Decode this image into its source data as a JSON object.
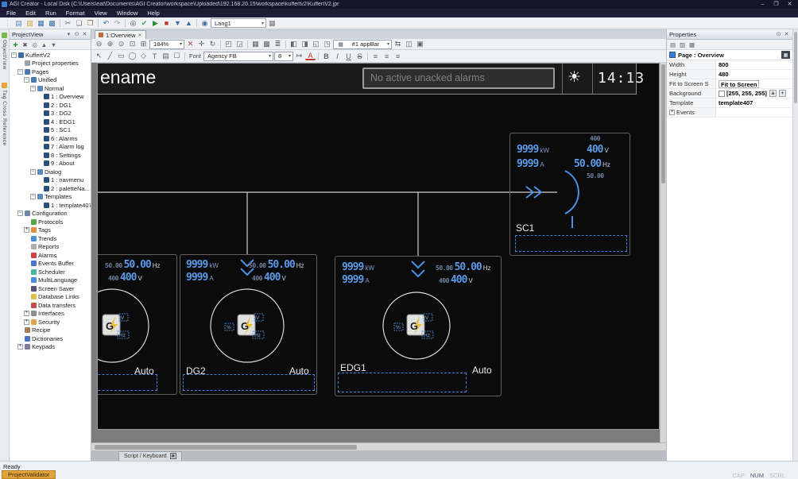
{
  "window": {
    "title": "AGI Creator - Local Disk (C:\\Users\\eat\\Documents\\AGI Creator\\workspace\\Uploaded\\192.168.20.15\\workspace\\kuffertv2\\KuffertV2.jpr",
    "controls": {
      "minimize": "–",
      "maximize": "❐",
      "close": "✕"
    }
  },
  "colors": {
    "accent_blue": "#4a90e2",
    "value_blue": "#5c9ae8",
    "selection_dash": "#3f7fd6",
    "validator_orange": "#e2a33c",
    "page_background": "#0b0b0b"
  },
  "menu": {
    "items": [
      "File",
      "Edit",
      "Run",
      "Format",
      "View",
      "Window",
      "Help"
    ]
  },
  "main_toolbar": {
    "language": "Lang1",
    "icons": [
      {
        "name": "new-project-icon",
        "glyph": "▤",
        "color": "#5b87c5"
      },
      {
        "name": "open-project-icon",
        "glyph": "▨",
        "color": "#d9a83c"
      },
      {
        "name": "save-icon",
        "glyph": "▦",
        "color": "#3a6ea5"
      },
      {
        "name": "save-all-icon",
        "glyph": "▩",
        "color": "#3a6ea5"
      },
      {
        "sep": true
      },
      {
        "name": "cut-icon",
        "glyph": "✂",
        "color": "#777777"
      },
      {
        "name": "copy-icon",
        "glyph": "❏",
        "color": "#777777"
      },
      {
        "name": "paste-icon",
        "glyph": "❐",
        "color": "#8a6d3b"
      },
      {
        "sep": true
      },
      {
        "name": "undo-icon",
        "glyph": "↶",
        "color": "#3a6ea5"
      },
      {
        "name": "redo-icon",
        "glyph": "↷",
        "color": "#8aa0b8"
      },
      {
        "sep": true
      },
      {
        "name": "find-icon",
        "glyph": "◎",
        "color": "#555555"
      },
      {
        "name": "validate-icon",
        "glyph": "✔",
        "color": "#3a9e3a"
      },
      {
        "name": "run-icon",
        "glyph": "▶",
        "color": "#2e8b2e"
      },
      {
        "name": "stop-icon",
        "glyph": "■",
        "color": "#c0392b"
      },
      {
        "name": "download-to-target-icon",
        "glyph": "▼",
        "color": "#3a6ea5"
      },
      {
        "name": "upload-from-target-icon",
        "glyph": "▲",
        "color": "#3a6ea5"
      },
      {
        "sep": true
      },
      {
        "name": "globe-icon",
        "glyph": "◉",
        "color": "#3a6ea5"
      }
    ],
    "icons_after": [
      {
        "name": "keypad-icon",
        "glyph": "▦",
        "color": "#777777"
      }
    ]
  },
  "side_tabs": [
    {
      "label": "ObjectView",
      "color": "#7ab648"
    },
    {
      "label": "Tag Cross Reference",
      "color": "#e8a33d"
    }
  ],
  "project_view": {
    "title": "ProjectView",
    "header_icons": [
      {
        "name": "window-position-icon",
        "glyph": "▾"
      },
      {
        "name": "pin-icon",
        "glyph": "⊙"
      },
      {
        "name": "close-panel-icon",
        "glyph": "✕"
      }
    ],
    "toolbar_icons": [
      {
        "name": "add-icon",
        "glyph": "✚",
        "color": "#2e8b2e"
      },
      {
        "name": "delete-icon",
        "glyph": "✖",
        "color": "#555555"
      },
      {
        "name": "search-icon",
        "glyph": "◎"
      },
      {
        "name": "move-up-icon",
        "glyph": "▲"
      },
      {
        "name": "move-down-icon",
        "glyph": "▼"
      }
    ],
    "tree": [
      {
        "label": "KuffertV2",
        "level": 0,
        "color": "#3a6ea5",
        "expand": "open"
      },
      {
        "label": "Project properties",
        "level": 1,
        "color": "#9aa2ab"
      },
      {
        "label": "Pages",
        "level": 1,
        "color": "#4a7ab5",
        "expand": "open"
      },
      {
        "label": "Unified",
        "level": 2,
        "color": "#4a7ab5",
        "expand": "open"
      },
      {
        "label": "Normal",
        "level": 3,
        "color": "#5b8ac0",
        "expand": "open"
      },
      {
        "label": "1 : Overview",
        "level": 4,
        "color": "#2d4f7a"
      },
      {
        "label": "2 : DG1",
        "level": 4,
        "color": "#2d4f7a"
      },
      {
        "label": "3 : DG2",
        "level": 4,
        "color": "#2d4f7a"
      },
      {
        "label": "4 : EDG1",
        "level": 4,
        "color": "#2d4f7a"
      },
      {
        "label": "5 : SC1",
        "level": 4,
        "color": "#2d4f7a"
      },
      {
        "label": "6 : Alarms",
        "level": 4,
        "color": "#2d4f7a"
      },
      {
        "label": "7 : Alarm log",
        "level": 4,
        "color": "#2d4f7a"
      },
      {
        "label": "8 : Settings",
        "level": 4,
        "color": "#2d4f7a"
      },
      {
        "label": "9 : About",
        "level": 4,
        "color": "#2d4f7a"
      },
      {
        "label": "Dialog",
        "level": 3,
        "color": "#5b8ac0",
        "expand": "open"
      },
      {
        "label": "1 : navmenu",
        "level": 4,
        "color": "#2d4f7a"
      },
      {
        "label": "2 : paletteNa...",
        "level": 4,
        "color": "#2d4f7a"
      },
      {
        "label": "Templates",
        "level": 3,
        "color": "#5b8ac0",
        "expand": "open"
      },
      {
        "label": "1 : template407",
        "level": 4,
        "color": "#2d4f7a"
      },
      {
        "label": "Configuration",
        "level": 1,
        "color": "#6a8aa5",
        "expand": "open"
      },
      {
        "label": "Protocols",
        "level": 2,
        "color": "#57a64a"
      },
      {
        "label": "Tags",
        "level": 2,
        "color": "#e09040",
        "expand": "closed"
      },
      {
        "label": "Trends",
        "level": 2,
        "color": "#4a90d9"
      },
      {
        "label": "Reports",
        "level": 2,
        "color": "#b0b0b0"
      },
      {
        "label": "Alarms",
        "level": 2,
        "color": "#cc4444"
      },
      {
        "label": "Events Buffer",
        "level": 2,
        "color": "#4a74c9"
      },
      {
        "label": "Scheduler",
        "level": 2,
        "color": "#46b8a8"
      },
      {
        "label": "MultiLanguage",
        "level": 2,
        "color": "#4a90d9"
      },
      {
        "label": "Screen Saver",
        "level": 2,
        "color": "#555577"
      },
      {
        "label": "Database Links",
        "level": 2,
        "color": "#d9c04a"
      },
      {
        "label": "Data transfers",
        "level": 2,
        "color": "#c05050"
      },
      {
        "label": "Interfaces",
        "level": 2,
        "color": "#909090",
        "expand": "closed"
      },
      {
        "label": "Security",
        "level": 2,
        "color": "#d9a84a",
        "expand": "closed"
      },
      {
        "label": "Recipe",
        "level": 1,
        "color": "#a77c52"
      },
      {
        "label": "Dictionaries",
        "level": 1,
        "color": "#4a74c9"
      },
      {
        "label": "Keypads",
        "level": 1,
        "color": "#7a7a9a",
        "expand": "closed"
      }
    ]
  },
  "editor": {
    "tab": {
      "label": "1:Overview",
      "close": "✕"
    },
    "toolbar1": {
      "zoom_icons": [
        {
          "name": "zoom-out-icon",
          "glyph": "⊖"
        },
        {
          "name": "zoom-in-icon",
          "glyph": "⊕"
        },
        {
          "name": "zoom-100-icon",
          "glyph": "⊙"
        },
        {
          "name": "zoom-fit-icon",
          "glyph": "⊡"
        },
        {
          "name": "zoom-region-icon",
          "glyph": "⊞"
        }
      ],
      "zoom_value": "184%",
      "edit_icons": [
        {
          "name": "delete-object-icon",
          "glyph": "✕",
          "color": "#b0453a"
        },
        {
          "name": "pan-icon",
          "glyph": "✛"
        },
        {
          "name": "rotate-icon",
          "glyph": "↻"
        },
        {
          "sep": true
        },
        {
          "name": "bring-to-front-icon",
          "glyph": "◰"
        },
        {
          "name": "send-to-back-icon",
          "glyph": "◲"
        },
        {
          "sep": true
        },
        {
          "name": "show-grid-icon",
          "glyph": "▦"
        },
        {
          "name": "snap-to-grid-icon",
          "glyph": "▩"
        },
        {
          "name": "layers-icon",
          "glyph": "≣"
        },
        {
          "sep": true
        },
        {
          "name": "align-left-objects-icon",
          "glyph": "◧"
        },
        {
          "name": "align-right-objects-icon",
          "glyph": "◨"
        },
        {
          "name": "align-top-objects-icon",
          "glyph": "◱"
        },
        {
          "name": "align-bottom-objects-icon",
          "glyph": "◳"
        }
      ],
      "widget_combo": {
        "icon_glyph": "▦",
        "value": "#1 appBar"
      },
      "tail_icons": [
        {
          "name": "tab-order-icon",
          "glyph": "⇆"
        },
        {
          "name": "group-icon",
          "glyph": "◫"
        },
        {
          "name": "ungroup-icon",
          "glyph": "▣"
        }
      ]
    },
    "toolbar2": {
      "draw_icons": [
        {
          "name": "select-cursor-icon",
          "glyph": "↖"
        },
        {
          "name": "line-tool-icon",
          "glyph": "╱"
        },
        {
          "name": "rect-tool-icon",
          "glyph": "▭"
        },
        {
          "name": "ellipse-tool-icon",
          "glyph": "◯"
        },
        {
          "name": "polygon-tool-icon",
          "glyph": "◇"
        },
        {
          "name": "text-tool-icon",
          "glyph": "T"
        },
        {
          "name": "image-tool-icon",
          "glyph": "▤"
        },
        {
          "name": "button-tool-icon",
          "glyph": "☐"
        },
        {
          "sep": true
        }
      ],
      "font_label": "Font",
      "font_name": "Agency FB",
      "font_size": "8",
      "format_icons": [
        {
          "name": "text-direction-icon",
          "glyph": "↦"
        },
        {
          "name": "font-color-icon",
          "glyph": "A",
          "cls": "fc"
        },
        {
          "sep": true
        },
        {
          "name": "bold-icon",
          "glyph": "B",
          "cls": "b"
        },
        {
          "name": "italic-icon",
          "glyph": "I",
          "cls": "i"
        },
        {
          "name": "underline-icon",
          "glyph": "U",
          "cls": "u"
        },
        {
          "name": "strike-icon",
          "glyph": "S",
          "cls": "s"
        },
        {
          "sep": true
        },
        {
          "name": "align-left-icon",
          "glyph": "≡"
        },
        {
          "name": "align-center-icon",
          "glyph": "≡"
        },
        {
          "name": "align-right-icon",
          "glyph": "≡"
        }
      ]
    },
    "script_tab": {
      "label": "Script / Keyboard",
      "pin_glyph": "▣"
    }
  },
  "hmi": {
    "header": {
      "title": "ename",
      "alarm": "No active unacked alarms",
      "sun": "☀",
      "time": "14:13"
    },
    "dg1": {
      "hz_set": "50.00",
      "hz": "50.00",
      "hz_unit": "Hz",
      "v_set": "400",
      "volts": "400",
      "volts_unit": "V",
      "mode": "Auto"
    },
    "dg2": {
      "kw": "9999",
      "kw_unit": "kW",
      "amps": "9999",
      "amps_unit": "A",
      "hz_set": "50.00",
      "hz": "50.00",
      "hz_unit": "Hz",
      "v_set": "400",
      "volts": "400",
      "volts_unit": "V",
      "label": "DG2",
      "mode": "Auto"
    },
    "edg1": {
      "kw": "9999",
      "kw_unit": "kW",
      "amps": "9999",
      "amps_unit": "A",
      "hz_set": "50.00",
      "hz": "50.00",
      "hz_unit": "Hz",
      "v_set": "400",
      "volts": "400",
      "volts_unit": "V",
      "label": "EDG1",
      "mode": "Auto"
    },
    "sc1": {
      "kw": "9999",
      "kw_unit": "kW",
      "amps": "9999",
      "amps_unit": "A",
      "v_set": "400",
      "volts": "400",
      "volts_unit": "V",
      "hz": "50.00",
      "hz_unit": "Hz",
      "hz_set": "50.00",
      "label": "SC1"
    },
    "gen_symbol": {
      "g": "G",
      "tags": [
        "V",
        "%",
        "Hz"
      ]
    }
  },
  "properties": {
    "title": "Properties",
    "header_icons": [
      {
        "name": "pin-icon",
        "glyph": "⊙"
      },
      {
        "name": "close-panel-icon",
        "glyph": "✕"
      }
    ],
    "toolbar_icons": [
      {
        "name": "categorized-icon",
        "glyph": "▤"
      },
      {
        "name": "alphabetical-icon",
        "glyph": "▥"
      },
      {
        "name": "property-pages-icon",
        "glyph": "▦"
      }
    ],
    "page_label": "Page : Overview",
    "title_button_glyph": "▦",
    "rows": [
      {
        "label": "Width",
        "value": "800"
      },
      {
        "label": "Height",
        "value": "480"
      },
      {
        "label": "Fit to Screen S",
        "value": "Fit to Screen",
        "combo": true
      },
      {
        "label": "Background",
        "value": "[255, 255, 255]",
        "swatch": "#ffffff",
        "extras": [
          "a",
          "+"
        ]
      },
      {
        "label": "Template",
        "value": "template407"
      },
      {
        "label": "Events",
        "value": "",
        "expander": "+"
      }
    ]
  },
  "status": {
    "ready": "Ready",
    "validator": "ProjectValidator",
    "flags": [
      {
        "label": "CAP",
        "active": false
      },
      {
        "label": "NUM",
        "active": true
      },
      {
        "label": "SCRL",
        "active": false
      }
    ]
  }
}
